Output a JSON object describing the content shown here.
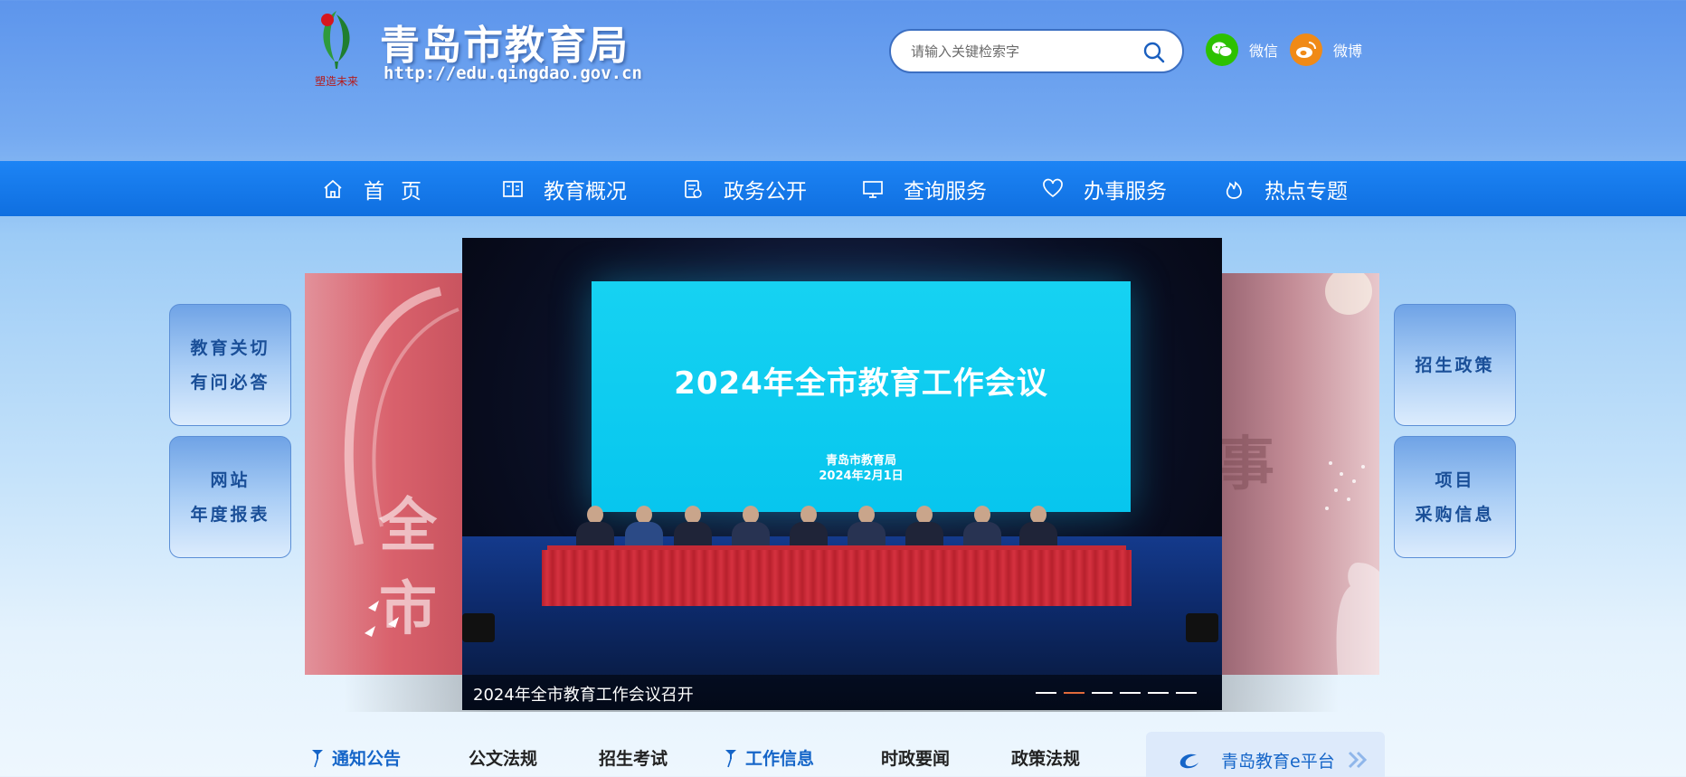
{
  "header": {
    "logo_icon": "emblem-logo-icon",
    "title": "青岛市教育局",
    "url": "http://edu.qingdao.gov.cn",
    "logo_caption": "塑造未来"
  },
  "search": {
    "placeholder": "请输入关键检索字",
    "icon": "search-icon"
  },
  "social": [
    {
      "label": "微信",
      "icon": "wechat-icon",
      "color": "#2dc100"
    },
    {
      "label": "微博",
      "icon": "weibo-icon",
      "color": "#f08a17"
    }
  ],
  "nav": {
    "items": [
      {
        "label": "首页",
        "icon": "home-icon"
      },
      {
        "label": "教育概况",
        "icon": "book-icon"
      },
      {
        "label": "政务公开",
        "icon": "document-icon"
      },
      {
        "label": "查询服务",
        "icon": "monitor-icon"
      },
      {
        "label": "办事服务",
        "icon": "heart-icon"
      },
      {
        "label": "热点专题",
        "icon": "flame-icon"
      }
    ]
  },
  "side_buttons": {
    "left": [
      {
        "line1": "教育关切",
        "line2": "有问必答"
      },
      {
        "line1": "网站",
        "line2": "年度报表"
      }
    ],
    "right": [
      {
        "line1": "招生政策",
        "line2": ""
      },
      {
        "line1": "项目",
        "line2": "采购信息"
      }
    ]
  },
  "carousel": {
    "caption": "2024年全市教育工作会议召开",
    "screen_title": "2024年全市教育工作会议",
    "screen_org": "青岛市教育局",
    "screen_date": "2024年2月1日",
    "left_slide_char": "全市",
    "right_slide_char": "事",
    "dot_count": 6,
    "active_dot": 2,
    "active_dot_color": "#e06a3b"
  },
  "tabs": [
    {
      "label": "通知公告",
      "active": true,
      "icon": "pin-icon"
    },
    {
      "label": "公文法规",
      "active": false
    },
    {
      "label": "招生考试",
      "active": false
    },
    {
      "label": "工作信息",
      "active": true,
      "icon": "pin-icon"
    },
    {
      "label": "时政要闻",
      "active": false
    },
    {
      "label": "政策法规",
      "active": false
    }
  ],
  "platform": {
    "label": "青岛教育e平台",
    "icon": "e-platform-icon",
    "arrow": "double-chevron-right-icon"
  },
  "colors": {
    "nav_blue": "#1477ea",
    "accent_blue": "#1565c8"
  }
}
